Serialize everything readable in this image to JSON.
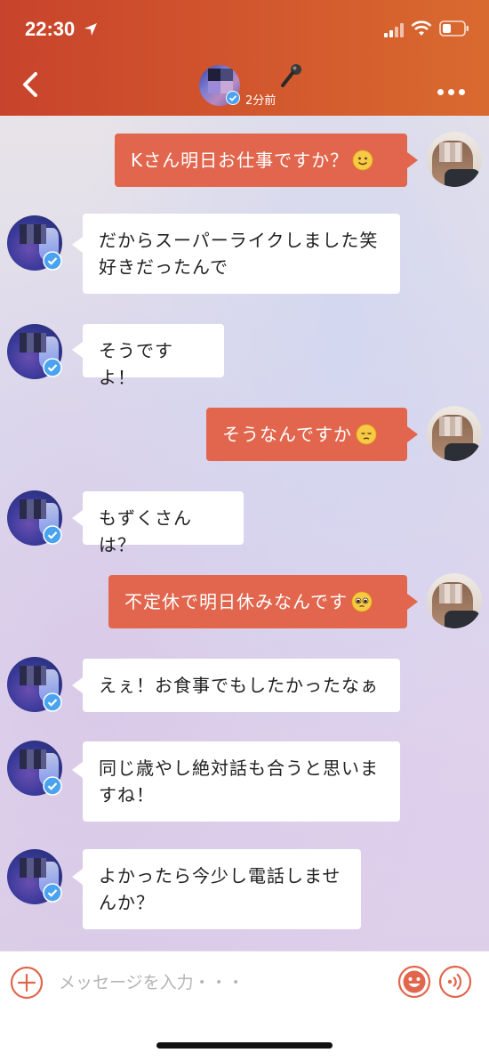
{
  "status_bar": {
    "time": "22:30"
  },
  "header": {
    "last_seen": "2分前"
  },
  "messages": [
    {
      "side": "out",
      "text": "Kさん明日お仕事ですか？",
      "emoji": "slightly-smiling-face"
    },
    {
      "side": "in",
      "lines": [
        "だからスーパーライクしました笑",
        "好きだったんで"
      ]
    },
    {
      "side": "in",
      "text": "そうですよ！"
    },
    {
      "side": "out",
      "text": "そうなんですか",
      "emoji": "pensive-face"
    },
    {
      "side": "in",
      "text": "もずくさんは？"
    },
    {
      "side": "out",
      "text": "不定休で明日休みなんです",
      "emoji": "pleading-face"
    },
    {
      "side": "in",
      "text": "えぇ！お食事でもしたかったなぁ"
    },
    {
      "side": "in",
      "lines": [
        "同じ歳やし絶対話も合うと思いま",
        "すね！"
      ]
    },
    {
      "side": "in",
      "lines": [
        "よかったら今少し電話しませ",
        "んか？"
      ]
    }
  ],
  "composer": {
    "placeholder": "メッセージを入力・・・"
  },
  "colors": {
    "header": "#cf4f2c",
    "outgoing_bubble": "#e1664d",
    "accent": "#e1664d",
    "verified": "#4aa3f0"
  }
}
